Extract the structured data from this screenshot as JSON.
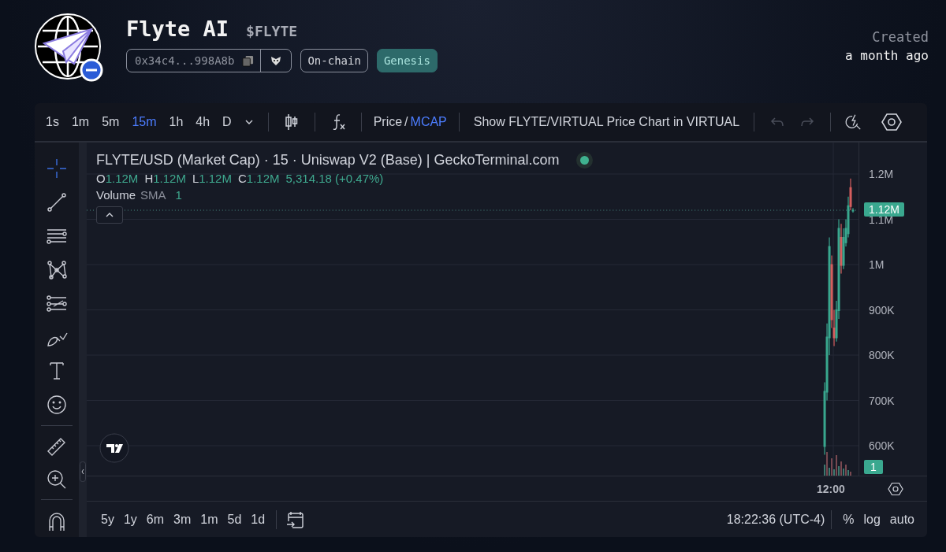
{
  "token": {
    "name": "Flyte AI",
    "ticker": "$FLYTE",
    "address": "0x34c4...998A8b",
    "tags": [
      {
        "label": "On-chain",
        "kind": "outline"
      },
      {
        "label": "Genesis",
        "kind": "filled"
      }
    ],
    "created_label": "Created",
    "created_value": "a month ago"
  },
  "toolbar": {
    "intervals": [
      {
        "label": "1s",
        "selected": false
      },
      {
        "label": "1m",
        "selected": false
      },
      {
        "label": "5m",
        "selected": false
      },
      {
        "label": "15m",
        "selected": true
      },
      {
        "label": "1h",
        "selected": false
      },
      {
        "label": "4h",
        "selected": false
      },
      {
        "label": "D",
        "selected": false
      }
    ],
    "price_modes": [
      {
        "label": "Price",
        "selected": false
      },
      {
        "label": "MCAP",
        "selected": true
      }
    ],
    "mode_separator": "/",
    "pair_button": "Show FLYTE/VIRTUAL Price Chart in VIRTUAL",
    "undo_enabled": false,
    "redo_enabled": false
  },
  "tool_groups": [
    [
      {
        "kind": "crosshair",
        "selected": true
      },
      {
        "kind": "trend-line",
        "selected": false
      },
      {
        "kind": "lines",
        "selected": false
      },
      {
        "kind": "pattern",
        "selected": false
      },
      {
        "kind": "projection",
        "selected": false
      },
      {
        "kind": "brush",
        "selected": false
      },
      {
        "kind": "text",
        "selected": false
      },
      {
        "kind": "emoji",
        "selected": false
      }
    ],
    [
      {
        "kind": "ruler",
        "selected": false
      },
      {
        "kind": "zoom",
        "selected": false
      }
    ],
    [
      {
        "kind": "magnet",
        "selected": false
      }
    ]
  ],
  "legend": {
    "title": "FLYTE/USD (Market Cap) · 15 · Uniswap V2 (Base) | GeckoTerminal.com",
    "ohlc": [
      {
        "key": "O",
        "value": "1.12M"
      },
      {
        "key": "H",
        "value": "1.12M"
      },
      {
        "key": "L",
        "value": "1.12M"
      },
      {
        "key": "C",
        "value": "1.12M"
      }
    ],
    "change": "5,314.18 (+0.47%)",
    "volume": {
      "label": "Volume",
      "indicator": "SMA",
      "value": "1"
    }
  },
  "price_scale": {
    "labels": [
      "1.2M",
      "1.1M",
      "1M",
      "900K",
      "800K",
      "700K",
      "600K"
    ],
    "current_price": "1.12M",
    "volume_badge": "1"
  },
  "time_axis": {
    "labels": [
      "12:00"
    ]
  },
  "bottom_bar": {
    "ranges": [
      "5y",
      "1y",
      "6m",
      "3m",
      "1m",
      "5d",
      "1d"
    ],
    "time": "18:22:36 (UTC-4)",
    "options": [
      "%",
      "log",
      "auto"
    ]
  }
}
